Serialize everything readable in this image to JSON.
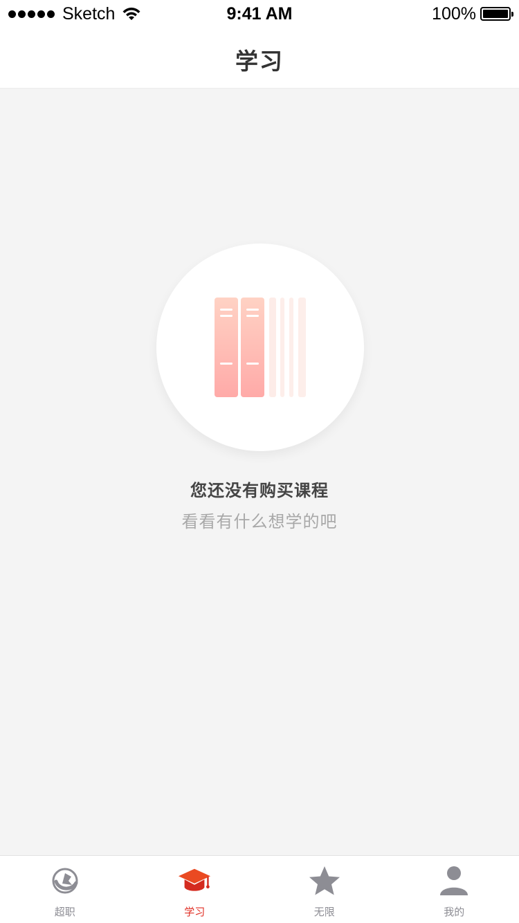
{
  "status_bar": {
    "carrier": "Sketch",
    "time": "9:41 AM",
    "battery_percent": "100%",
    "battery_level": 1.0
  },
  "nav": {
    "title": "学习"
  },
  "empty_state": {
    "icon": "books-icon",
    "title": "您还没有购买课程",
    "subtitle": "看看有什么想学的吧"
  },
  "tab_bar": {
    "active_index": 1,
    "active_color": "#e02e24",
    "inactive_color": "#8d8d94",
    "tabs": [
      {
        "label": "超职",
        "icon": "career-globe-icon"
      },
      {
        "label": "学习",
        "icon": "graduation-cap-icon"
      },
      {
        "label": "无限",
        "icon": "star-icon"
      },
      {
        "label": "我的",
        "icon": "person-icon"
      }
    ]
  }
}
